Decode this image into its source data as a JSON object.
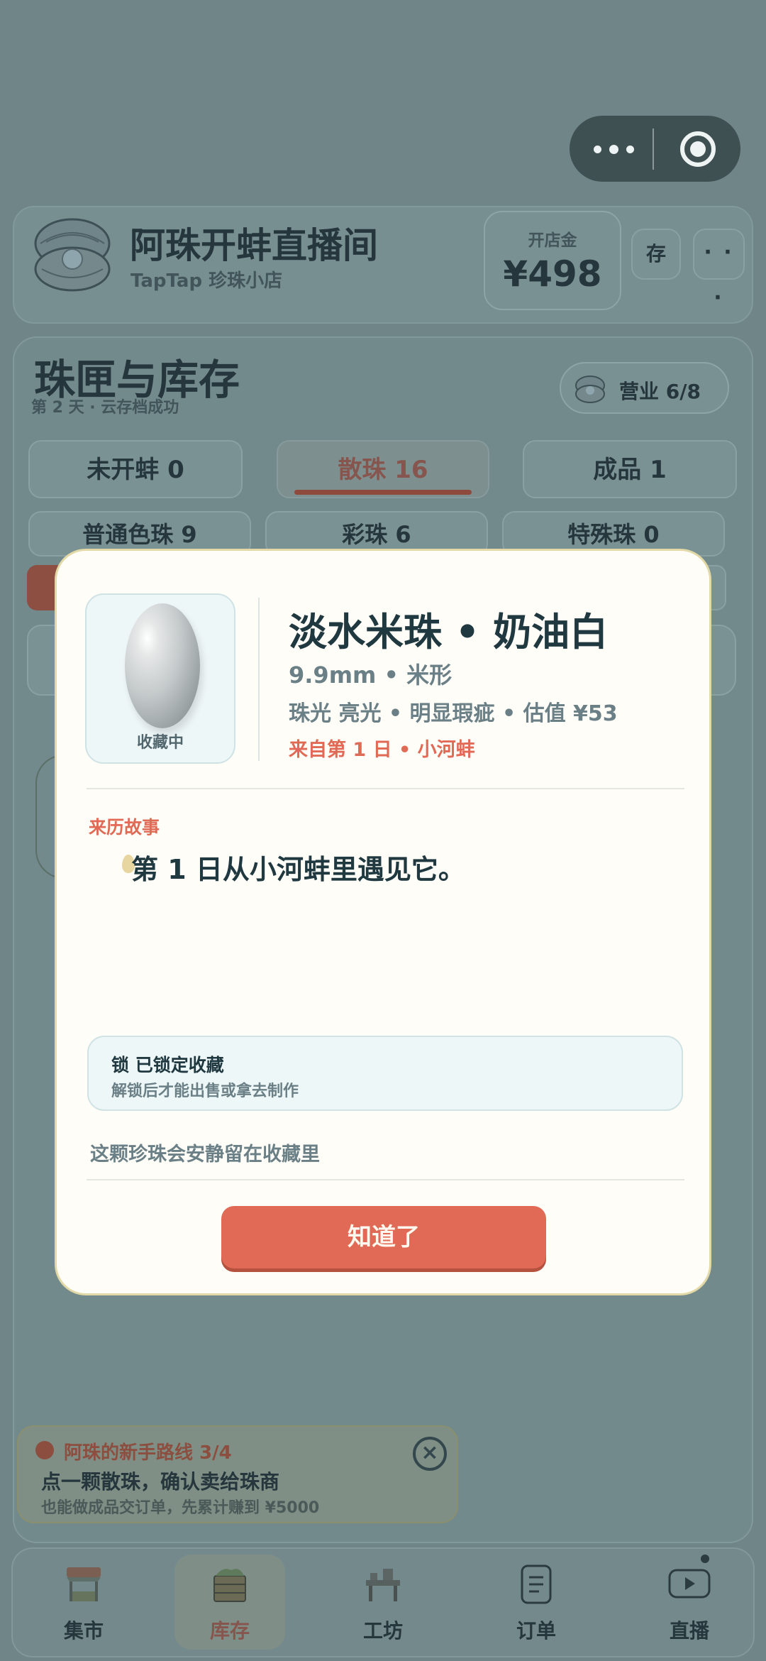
{
  "header": {
    "shop_name": "阿珠开蚌直播间",
    "shop_sub": "TapTap 珍珠小店",
    "gold_label": "开店金",
    "gold_value": "¥498",
    "save_label": "存",
    "more_label": "· · ·"
  },
  "inventory": {
    "title": "珠匣与库存",
    "subtitle": "第 2 天 · 云存档成功",
    "business": "营业 6/8",
    "tabs": [
      "未开蚌 0",
      "散珠 16",
      "成品 1"
    ],
    "active_tab": "散珠 16",
    "subtabs": [
      "普通色珠 9",
      "彩珠 6",
      "特殊珠 0"
    ]
  },
  "modal": {
    "pearl_tag": "收藏中",
    "name": "淡水米珠 • 奶油白",
    "size_line": "9.9mm • 米形",
    "quality_line": "珠光 亮光 • 明显瑕疵 • 估值 ¥53",
    "source_line": "来自第 1 日 • 小河蚌",
    "story_heading": "来历故事",
    "story_text": "第 1 日从小河蚌里遇见它。",
    "lock_title": "锁 已锁定收藏",
    "lock_sub": "解锁后才能出售或拿去制作",
    "note": "这颗珍珠会安静留在收藏里",
    "ok_button": "知道了"
  },
  "guide": {
    "title": "阿珠的新手路线 3/4",
    "main": "点一颗散珠，确认卖给珠商",
    "sub": "也能做成品交订单，先累计赚到 ¥5000",
    "close": "×"
  },
  "nav": {
    "items": [
      "集市",
      "库存",
      "工坊",
      "订单",
      "直播"
    ],
    "active": "库存"
  },
  "colors": {
    "accent": "#e06a55",
    "modal_bg": "#fffdf7",
    "overlay_bg": "#6f8587"
  }
}
